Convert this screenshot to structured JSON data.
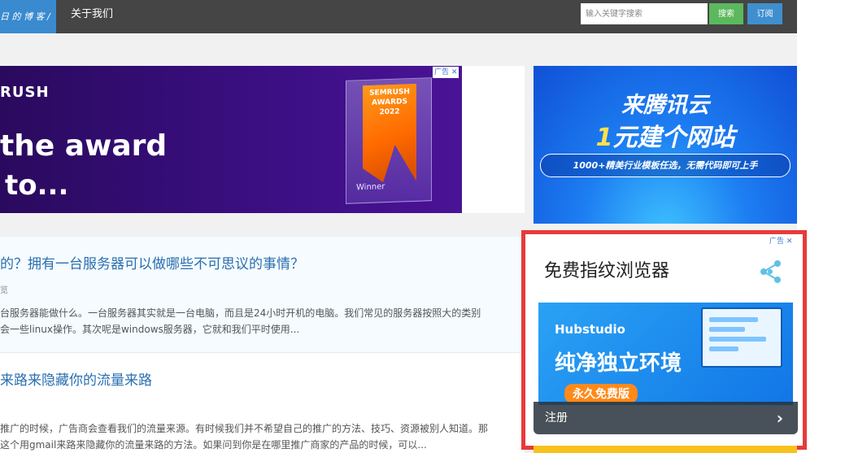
{
  "header": {
    "logo_text": "日 的 博 客 /",
    "nav_about": "关于我们",
    "search_placeholder": "输入关键字搜索",
    "search_button": "搜索",
    "subscribe_button": "订阅"
  },
  "banner_ad": {
    "brand": "RUSH",
    "headline_1": "the award",
    "headline_2": "to...",
    "trophy_text": "SEMRUSH AWARDS 2022",
    "trophy_winner": "Winner",
    "ad_mark": "广告 ✕"
  },
  "articles": [
    {
      "title": "的？拥有一台服务器可以做哪些不可思议的事情？",
      "meta": "览",
      "excerpt_1": "台服务器能做什么。一台服务器其实就是一台电脑，而且是24小时开机的电脑。我们常见的服务器按照大的类别",
      "excerpt_2": "会一些linux操作。其次呢是windows服务器，它就和我们平时使用..."
    },
    {
      "title": "来路来隐藏你的流量来路",
      "meta": "",
      "excerpt_1": "推广的时候，广告商会查看我们的流量来源。有时候我们并不希望自己的推广的方法、技巧、资源被别人知道。那",
      "excerpt_2": "这个用gmail来路来隐藏你的流量来路的方法。如果问到你是在哪里推广商家的产品的时候，可以..."
    }
  ],
  "sidebar": {
    "tencent_ad": {
      "line_1": "来腾讯云",
      "line_2_accent": "1",
      "line_2_rest": "元建个网站",
      "pill": "1000+精美行业模板任选，无需代码即可上手"
    },
    "hub_ad": {
      "ad_mark": "广告 ✕",
      "title": "免费指纹浏览器",
      "logo": "Hubstudio",
      "slogan": "纯净独立环境",
      "free_badge": "永久免费版",
      "cta_label": "注册",
      "cta_arrow": "›"
    }
  },
  "colors": {
    "topbar": "#454545",
    "logo_bg": "#3a8ad0",
    "search_btn": "#5cb85c",
    "subscribe_btn": "#3f8fcf",
    "link": "#2a6fb0",
    "highlight_frame": "#e83a3a"
  }
}
